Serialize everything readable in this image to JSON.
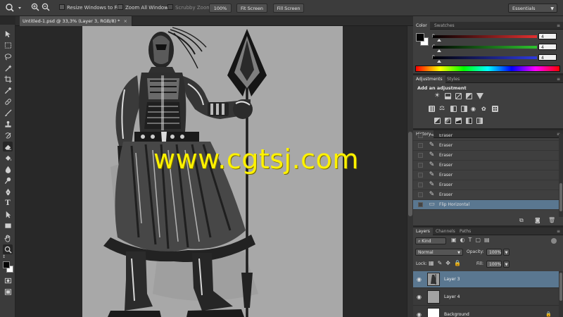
{
  "options_bar": {
    "resize_windows_label": "Resize Windows to Fit",
    "zoom_all_label": "Zoom All Windows",
    "scrubby_zoom_label": "Scrubby Zoom",
    "zoom_100_label": "100%",
    "fit_screen_label": "Fit Screen",
    "fill_screen_label": "Fill Screen",
    "workspace": "Essentials"
  },
  "document": {
    "tab_title": "Untitled-1.psd @ 33,3% (Layer 3, RGB/8) *",
    "watermark": "www.cgtsj.com"
  },
  "color_panel": {
    "tabs": [
      "Color",
      "Swatches"
    ],
    "channels": [
      {
        "label": "R",
        "value": "4",
        "color": "#e23030"
      },
      {
        "label": "G",
        "value": "4",
        "color": "#2ec42e"
      },
      {
        "label": "B",
        "value": "4",
        "color": "#2e3ae0"
      }
    ]
  },
  "adjustments_panel": {
    "tabs": [
      "Adjustments",
      "Styles"
    ],
    "heading": "Add an adjustment"
  },
  "history_panel": {
    "tab": "History",
    "items": [
      {
        "label": "Eraser"
      },
      {
        "label": "Eraser"
      },
      {
        "label": "Eraser"
      },
      {
        "label": "Eraser"
      },
      {
        "label": "Eraser"
      },
      {
        "label": "Eraser"
      },
      {
        "label": "Eraser"
      },
      {
        "label": "Flip Horizontal"
      }
    ]
  },
  "layers_panel": {
    "tabs": [
      "Layers",
      "Channels",
      "Paths"
    ],
    "filter_kind": "Kind",
    "blend_mode": "Normal",
    "opacity_label": "Opacity:",
    "opacity_value": "100%",
    "lock_label": "Lock:",
    "fill_label": "Fill:",
    "fill_value": "100%",
    "layers": [
      {
        "name": "Layer 3"
      },
      {
        "name": "Layer 4"
      },
      {
        "name": "Background"
      }
    ]
  },
  "colors": {
    "accent_selection": "#5a7790",
    "watermark": "#fff200"
  }
}
